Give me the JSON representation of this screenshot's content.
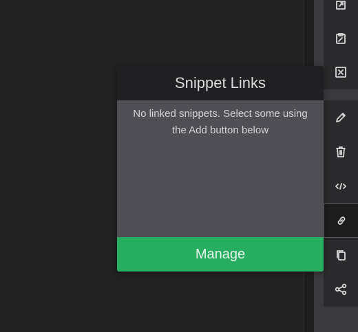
{
  "popup": {
    "title": "Snippet Links",
    "empty_message": "No linked snippets. Select some using the Add button below",
    "manage_label": "Manage"
  },
  "toolbar": {
    "items": [
      {
        "name": "export-icon"
      },
      {
        "name": "paste-icon"
      },
      {
        "name": "close-box-icon"
      },
      {
        "name": "pencil-icon"
      },
      {
        "name": "trash-icon"
      },
      {
        "name": "code-icon"
      },
      {
        "name": "link-icon",
        "active": true
      },
      {
        "name": "copy-icon"
      },
      {
        "name": "share-icon"
      }
    ]
  },
  "colors": {
    "background": "#222223",
    "toolbar": "#2a2a2c",
    "popup_header": "#202022",
    "popup_body": "#4f4f55",
    "manage": "#27ae60",
    "arrow": "#e8262a"
  }
}
